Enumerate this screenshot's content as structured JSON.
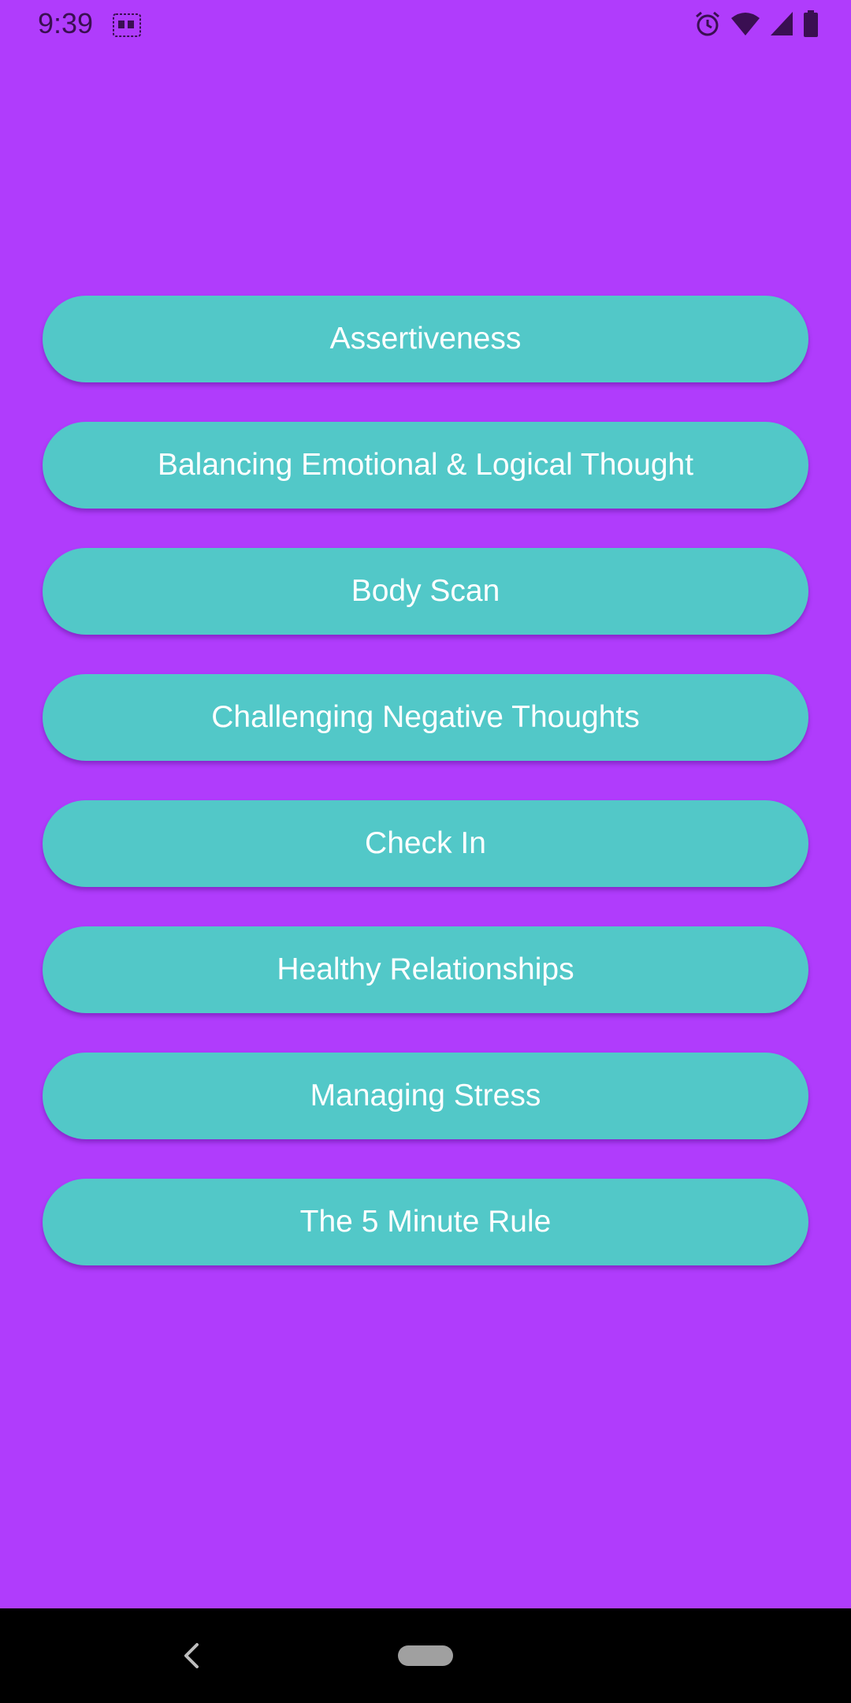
{
  "status_bar": {
    "time": "9:39",
    "icons": [
      "notification-icon",
      "alarm-icon",
      "wifi-icon",
      "signal-icon",
      "battery-icon"
    ]
  },
  "topics": [
    {
      "label": "Assertiveness"
    },
    {
      "label": "Balancing Emotional & Logical Thought"
    },
    {
      "label": "Body Scan"
    },
    {
      "label": "Challenging Negative Thoughts"
    },
    {
      "label": "Check In"
    },
    {
      "label": "Healthy Relationships"
    },
    {
      "label": "Managing Stress"
    },
    {
      "label": "The 5 Minute Rule"
    }
  ],
  "nav_bar": {
    "icons": [
      "back-icon",
      "home-pill-icon"
    ]
  },
  "colors": {
    "background": "#b03cfc",
    "button": "#52c8c8",
    "button_text": "#ffffff",
    "status_icons": "#3a0f52",
    "nav_bar": "#000000"
  }
}
